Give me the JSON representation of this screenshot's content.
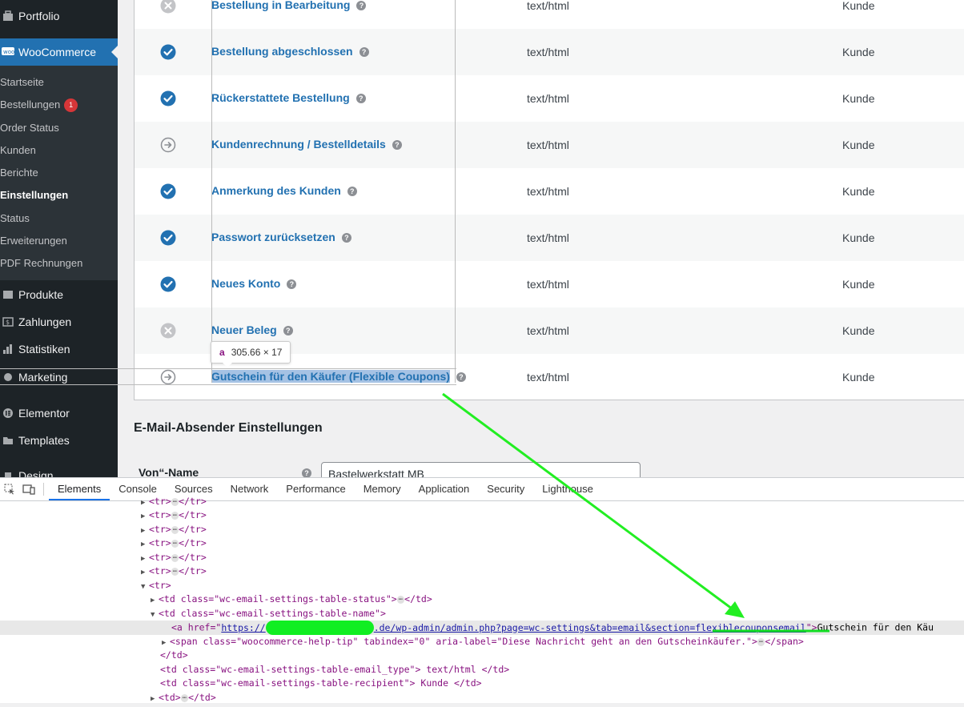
{
  "sidebar": {
    "portfolio": "Portfolio",
    "woocommerce": "WooCommerce",
    "submenu": [
      "Startseite",
      "Bestellungen",
      "Order Status",
      "Kunden",
      "Berichte",
      "Einstellungen",
      "Status",
      "Erweiterungen",
      "PDF Rechnungen"
    ],
    "orders_badge": "1",
    "produkte": "Produkte",
    "zahlungen": "Zahlungen",
    "statistiken": "Statistiken",
    "marketing": "Marketing",
    "elementor": "Elementor",
    "templates": "Templates",
    "design": "Design"
  },
  "emails": {
    "rows": [
      {
        "name": "Bestellung in Bearbeitung",
        "status": "disabled",
        "type": "text/html",
        "recipient": "Kunde"
      },
      {
        "name": "Bestellung abgeschlossen",
        "status": "enabled",
        "type": "text/html",
        "recipient": "Kunde"
      },
      {
        "name": "Rückerstattete Bestellung",
        "status": "enabled",
        "type": "text/html",
        "recipient": "Kunde"
      },
      {
        "name": "Kundenrechnung / Bestelldetails",
        "status": "manual",
        "type": "text/html",
        "recipient": "Kunde"
      },
      {
        "name": "Anmerkung des Kunden",
        "status": "enabled",
        "type": "text/html",
        "recipient": "Kunde"
      },
      {
        "name": "Passwort zurücksetzen",
        "status": "enabled",
        "type": "text/html",
        "recipient": "Kunde"
      },
      {
        "name": "Neues Konto",
        "status": "enabled",
        "type": "text/html",
        "recipient": "Kunde"
      },
      {
        "name": "Neuer Beleg",
        "status": "disabled",
        "type": "text/html",
        "recipient": "Kunde"
      },
      {
        "name": "Gutschein für den Käufer (Flexible Coupons)",
        "status": "manual",
        "type": "text/html",
        "recipient": "Kunde"
      }
    ]
  },
  "inspect_tooltip": {
    "tag": "a",
    "size": "305.66 × 17"
  },
  "sender": {
    "section_title": "E-Mail-Absender Einstellungen",
    "from_name_label": "Von“-Name",
    "from_name_value": "Bastelwerkstatt MB"
  },
  "devtools": {
    "tabs": [
      "Elements",
      "Console",
      "Sources",
      "Network",
      "Performance",
      "Memory",
      "Application",
      "Security",
      "Lighthouse"
    ],
    "active_tab": "Elements",
    "lines": {
      "tr_collapsed": "<tr>",
      "tr_close": "</tr>",
      "tr_open": "<tr>",
      "td_status_open": "<td class=\"wc-email-settings-table-status\">",
      "td_close": "</td>",
      "td_name_open": "<td class=\"wc-email-settings-table-name\">",
      "a_open_prefix": "<a href=\"",
      "url_start": "https://",
      "url_rest": ".de/wp-admin/admin.php?page=wc-settings&tab=email&section=flexiblecouponsemail",
      "a_open_suffix": "\">",
      "a_text": "Gutschein für den Käu",
      "span_open": "<span class=\"woocommerce-help-tip\" tabindex=\"0\" aria-label=\"Diese Nachricht geht an den Gutscheinkäufer.\">",
      "span_close": "</span>",
      "td_type": "<td class=\"wc-email-settings-table-email_type\"> text/html </td>",
      "td_recipient": "<td class=\"wc-email-settings-table-recipient\"> Kunde </td>",
      "td_generic": "<td>"
    }
  }
}
